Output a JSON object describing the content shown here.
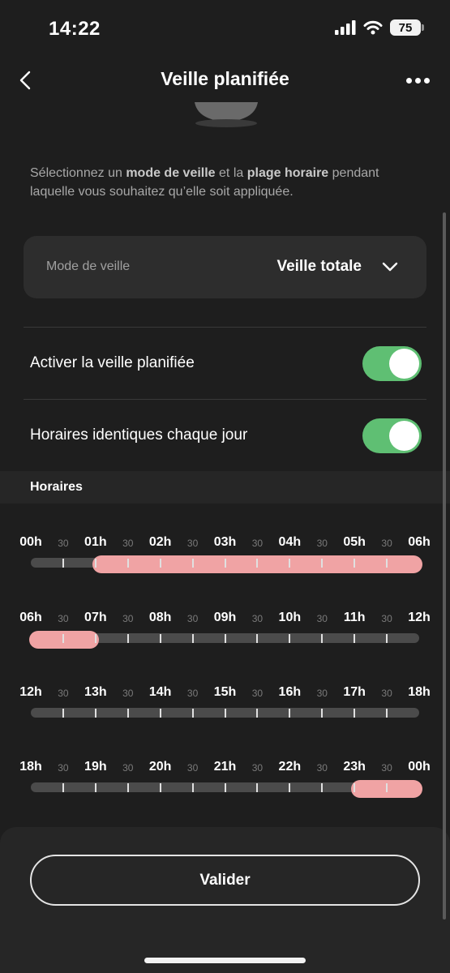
{
  "status_bar": {
    "time": "14:22",
    "battery": "75"
  },
  "nav": {
    "title": "Veille planifiée"
  },
  "description": {
    "part1": "Sélectionnez un ",
    "bold1": "mode de veille",
    "part2": " et la ",
    "bold2": "plage horaire",
    "part3": " pendant laquelle vous souhaitez qu’elle soit appliquée."
  },
  "mode": {
    "label": "Mode de veille",
    "value": "Veille totale"
  },
  "toggles": [
    {
      "label": "Activer la veille planifiée",
      "on": true
    },
    {
      "label": "Horaires identiques chaque jour",
      "on": true
    }
  ],
  "section_title": "Horaires",
  "timelines": [
    {
      "labels": [
        "00h",
        "30",
        "01h",
        "30",
        "02h",
        "30",
        "03h",
        "30",
        "04h",
        "30",
        "05h",
        "30",
        "06h"
      ],
      "selected": [
        [
          1,
          6
        ]
      ]
    },
    {
      "labels": [
        "06h",
        "30",
        "07h",
        "30",
        "08h",
        "30",
        "09h",
        "30",
        "10h",
        "30",
        "11h",
        "30",
        "12h"
      ],
      "selected": [
        [
          6,
          7
        ]
      ]
    },
    {
      "labels": [
        "12h",
        "30",
        "13h",
        "30",
        "14h",
        "30",
        "15h",
        "30",
        "16h",
        "30",
        "17h",
        "30",
        "18h"
      ],
      "selected": []
    },
    {
      "labels": [
        "18h",
        "30",
        "19h",
        "30",
        "20h",
        "30",
        "21h",
        "30",
        "22h",
        "30",
        "23h",
        "30",
        "00h"
      ],
      "selected": [
        [
          23,
          24
        ]
      ]
    }
  ],
  "validate_label": "Valider",
  "colors": {
    "toggle_on": "#5fbf73",
    "selected_range": "#f0a3a4",
    "track": "#4b4b4b"
  }
}
